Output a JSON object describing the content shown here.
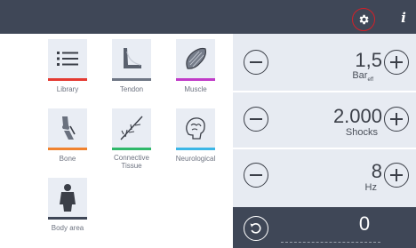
{
  "header": {
    "settings_icon": "gear-icon",
    "info_label": "i"
  },
  "library": {
    "items": [
      {
        "label": "Library",
        "icon": "list-icon",
        "color": "#e43a32"
      },
      {
        "label": "Tendon",
        "icon": "tendon-icon",
        "color": "#6e7684"
      },
      {
        "label": "Muscle",
        "icon": "muscle-icon",
        "color": "#c03bc8"
      },
      {
        "label": "Bone",
        "icon": "knee-bone-icon",
        "color": "#f0822e"
      },
      {
        "label": "Connective\nTissue",
        "icon": "connective-tissue-icon",
        "color": "#2fb86a"
      },
      {
        "label": "Neurological",
        "icon": "brain-icon",
        "color": "#3bb6e6"
      },
      {
        "label": "Body area",
        "icon": "body-icon",
        "color": "#3f4757"
      }
    ]
  },
  "parameters": {
    "pressure": {
      "value": "1,5",
      "unit": "Bar",
      "unit_sub": "eff"
    },
    "shocks": {
      "value": "2.000",
      "unit": "Shocks"
    },
    "frequency": {
      "value": "8",
      "unit": "Hz"
    }
  },
  "counter": {
    "value": "0"
  }
}
